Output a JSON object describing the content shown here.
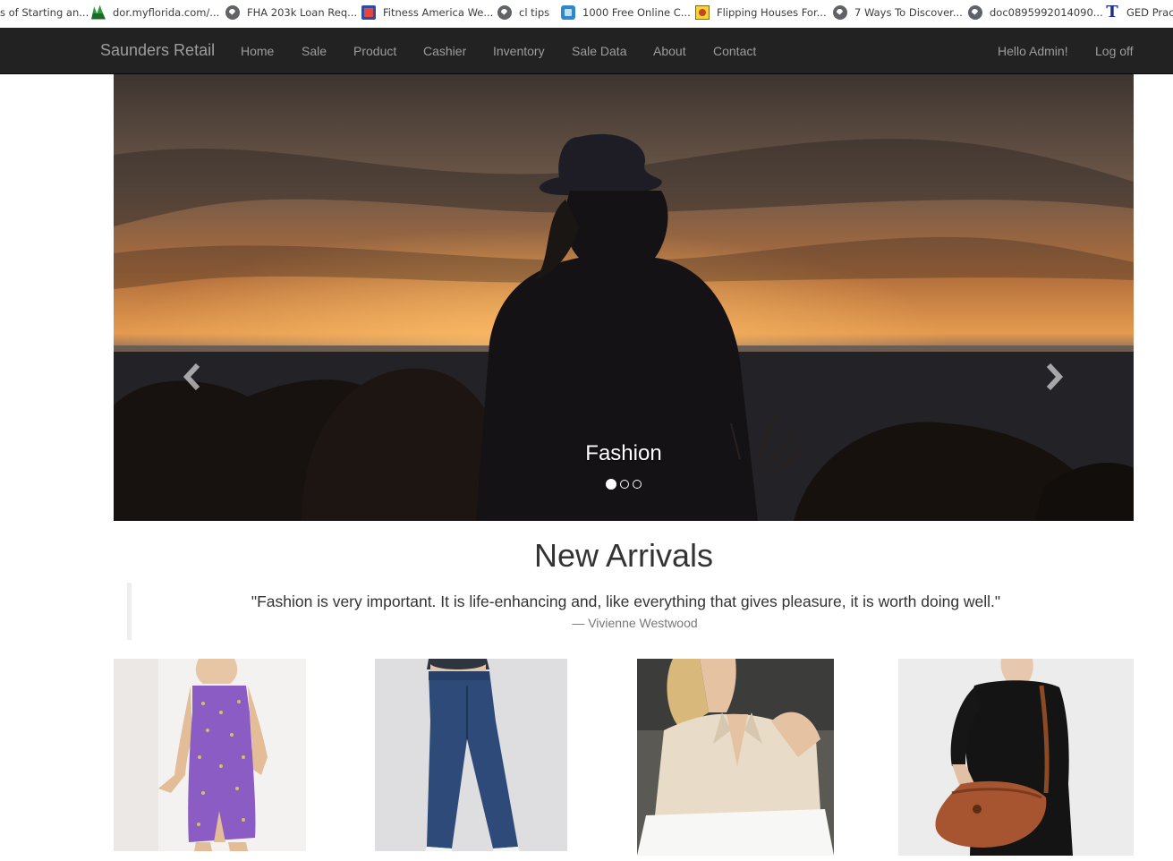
{
  "bookmarks": [
    {
      "label": "s of Starting an...",
      "icon": "none"
    },
    {
      "label": "dor.myflorida.com/...",
      "icon": "palm-icon"
    },
    {
      "label": "FHA 203k Loan Req...",
      "icon": "globe-icon"
    },
    {
      "label": "Fitness America We...",
      "icon": "fitness-icon"
    },
    {
      "label": "cl tips",
      "icon": "globe-icon"
    },
    {
      "label": "1000 Free Online C...",
      "icon": "square-icon"
    },
    {
      "label": "Flipping Houses For...",
      "icon": "flip-icon"
    },
    {
      "label": "7 Ways To Discover...",
      "icon": "globe-icon"
    },
    {
      "label": "doc0895992014090...",
      "icon": "globe-icon"
    },
    {
      "label": "GED Pract",
      "icon": "tee-icon"
    }
  ],
  "navbar": {
    "brand": "Saunders Retail",
    "links": [
      "Home",
      "Sale",
      "Product",
      "Cashier",
      "Inventory",
      "Sale Data",
      "About",
      "Contact"
    ],
    "greeting": "Hello Admin!",
    "logoff": "Log off",
    "background": "#222222",
    "text_color": "#9d9d9d"
  },
  "carousel": {
    "caption": "Fashion",
    "slide_count": 3,
    "active_index": 0,
    "prev_icon": "chevron-left-icon",
    "next_icon": "chevron-right-icon"
  },
  "section": {
    "heading": "New Arrivals",
    "quote": "\"Fashion is very important. It is life-enhancing and, like everything that gives pleasure, it is worth doing well.\"",
    "source": "— Vivienne Westwood"
  },
  "products": [
    {
      "name": "purple-dress-image"
    },
    {
      "name": "jeans-image"
    },
    {
      "name": "satin-blouse-image"
    },
    {
      "name": "leather-handbag-image"
    }
  ]
}
